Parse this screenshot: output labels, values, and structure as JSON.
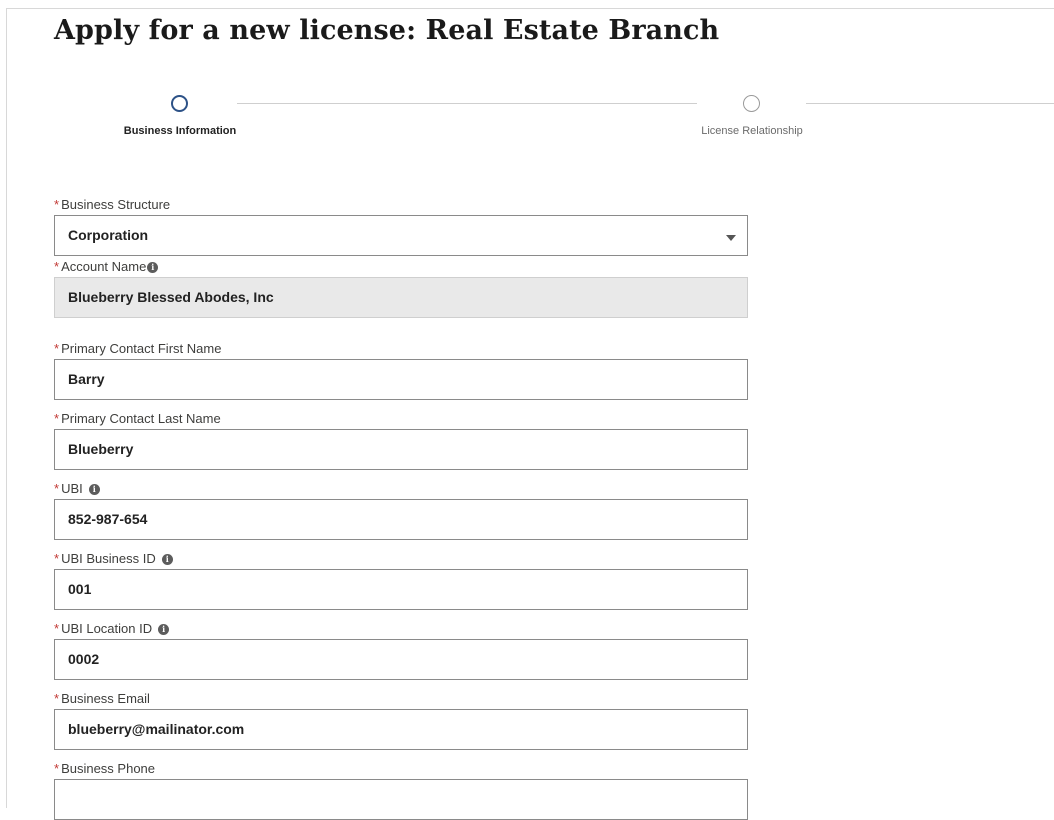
{
  "page": {
    "title": "Apply for a new license: Real Estate Branch"
  },
  "steps": [
    {
      "label": "Business Information",
      "state": "active"
    },
    {
      "label": "License Relationship",
      "state": "inactive"
    }
  ],
  "form": {
    "required_marker": "*",
    "info_glyph": "i",
    "business_structure": {
      "label": "Business Structure",
      "value": "Corporation"
    },
    "account_name": {
      "label": "Account Name",
      "value": "Blueberry Blessed Abodes, Inc"
    },
    "first_name": {
      "label": "Primary Contact First Name",
      "value": "Barry"
    },
    "last_name": {
      "label": "Primary Contact Last Name",
      "value": "Blueberry"
    },
    "ubi": {
      "label": "UBI",
      "value": "852-987-654"
    },
    "ubi_business_id": {
      "label": "UBI Business ID",
      "value": "001"
    },
    "ubi_location_id": {
      "label": "UBI Location ID",
      "value": "0002"
    },
    "business_email": {
      "label": "Business Email",
      "value": "blueberry@mailinator.com"
    },
    "business_phone": {
      "label": "Business Phone",
      "value": ""
    }
  },
  "colors": {
    "required": "#c23934",
    "active_step": "#2d5287",
    "readonly_bg": "#e9e9e9"
  }
}
